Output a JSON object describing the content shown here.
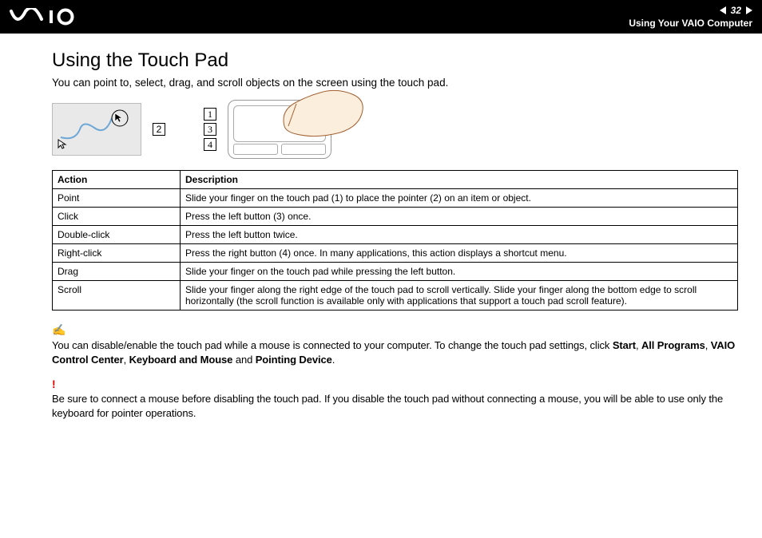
{
  "header": {
    "page_number": "32",
    "section_title": "Using Your VAIO Computer"
  },
  "page": {
    "title": "Using the Touch Pad",
    "intro": "You can point to, select, drag, and scroll objects on the screen using the touch pad."
  },
  "callouts": [
    "2",
    "1",
    "3",
    "4"
  ],
  "table": {
    "headers": [
      "Action",
      "Description"
    ],
    "rows": [
      {
        "action": "Point",
        "desc": "Slide your finger on the touch pad (1) to place the pointer (2) on an item or object."
      },
      {
        "action": "Click",
        "desc": "Press the left button (3) once."
      },
      {
        "action": "Double-click",
        "desc": "Press the left button twice."
      },
      {
        "action": "Right-click",
        "desc": "Press the right button (4) once. In many applications, this action displays a shortcut menu."
      },
      {
        "action": "Drag",
        "desc": "Slide your finger on the touch pad while pressing the left button."
      },
      {
        "action": "Scroll",
        "desc": "Slide your finger along the right edge of the touch pad to scroll vertically. Slide your finger along the bottom edge to scroll horizontally (the scroll function is available only with applications that support a touch pad scroll feature)."
      }
    ]
  },
  "tip": {
    "t1": "You can disable/enable the touch pad while a mouse is connected to your computer. To change the touch pad settings, click ",
    "b1": "Start",
    "s1": ", ",
    "b2": "All Programs",
    "s2": ", ",
    "b3": "VAIO Control Center",
    "s3": ", ",
    "b4": "Keyboard and Mouse",
    "s4": " and ",
    "b5": "Pointing Device",
    "s5": "."
  },
  "warn": {
    "text": "Be sure to connect a mouse before disabling the touch pad. If you disable the touch pad without connecting a mouse, you will be able to use only the keyboard for pointer operations."
  }
}
